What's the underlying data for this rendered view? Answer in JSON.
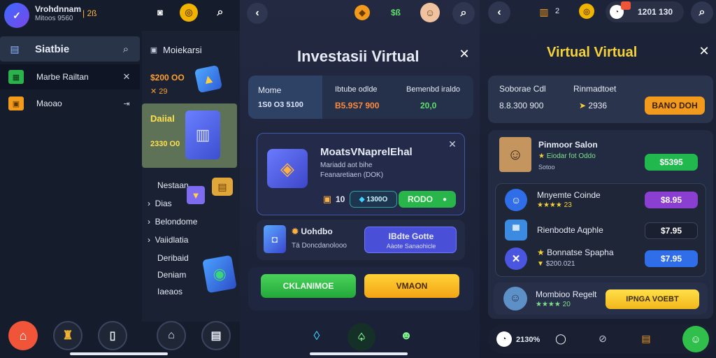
{
  "screen1": {
    "user_name": "Vrohdnnam",
    "user_sub": "Mitoos 9560",
    "balance": "| 2ß",
    "sidebar": {
      "header": "Siatbie",
      "items": [
        {
          "label": "Marbe Railtan"
        },
        {
          "label": "Maoao"
        }
      ]
    },
    "panel": {
      "header": "Moiekarsi",
      "price": "$200 OO",
      "price_sub": "✕ 29",
      "card_title": "Daiial",
      "card_value": "2330 O0",
      "section_label": "Nestaan",
      "menu": [
        "Dias",
        "Belondome",
        "Vaiidlatia",
        "Deribaid",
        "Deniam",
        "Iaeaos"
      ]
    }
  },
  "screen2": {
    "title": "Investasii Virtual",
    "tabs": [
      {
        "label": "Mome",
        "value": "1S0 O3 5100"
      },
      {
        "label": "Ibtube odlde",
        "value": "B5.9S7 900"
      },
      {
        "label": "Bemenbd iraldo",
        "value": "20,0"
      }
    ],
    "product": {
      "title": "MoatsVNaprelEhal",
      "line1": "Mariadd aot bihe",
      "line2": "Feanaretiaen (DOK)",
      "qty": "10",
      "chip_value": "1300O",
      "action": "RODO"
    },
    "secondary": {
      "title": "Uohdbo",
      "sub": "Tä Doncdanolooo",
      "button_title": "IBdte Gotte",
      "button_sub": "Aàote Sanaohicle"
    },
    "buttons": {
      "green": "CKLANIMOE",
      "yellow": "VMAON"
    }
  },
  "screen3": {
    "stat": "2",
    "title": "Virtual Virtual",
    "header_right": "1201 130",
    "balance_card": {
      "label1": "Soborae Cdl",
      "value1": "8.8.300 900",
      "label2": "Rinmadtoet",
      "value2": "2936",
      "button": "BANO DOH"
    },
    "list": [
      {
        "name": "Pinmoor Salon",
        "meta1": "Eiodar fot Oddo",
        "meta2": "Sotoo",
        "price": "$5395",
        "color": "#21b84e"
      },
      {
        "name": "Mnyemte Coinde",
        "meta1": "★★★★ 23",
        "meta2": "",
        "price": "$8.95",
        "color": "#8b3fd1"
      },
      {
        "name": "Rienbodte Aqphle",
        "meta1": "",
        "meta2": "",
        "price": "$7.95",
        "color": "#1f2636"
      },
      {
        "name": "Bonnatse Spapha",
        "meta1": "$200.021",
        "meta2": "",
        "price": "$7.95",
        "color": "#2f6ee8"
      },
      {
        "name": "Mombioo Regelt",
        "meta1": "★★★★ 20",
        "meta2": "",
        "price": "IPNGA VOEBT",
        "color": "#f6c918"
      }
    ],
    "bottom_value": "2130%"
  }
}
